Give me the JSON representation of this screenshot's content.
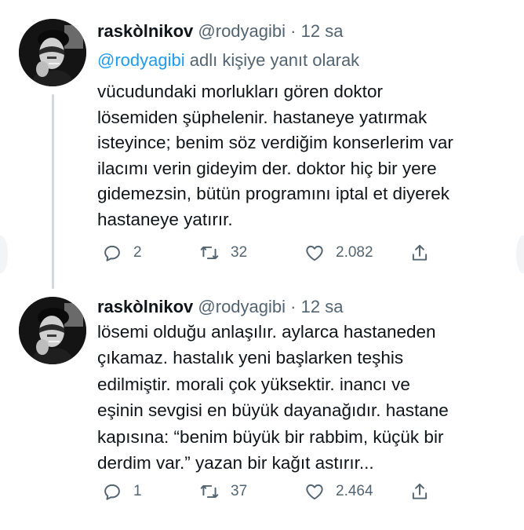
{
  "tweets": [
    {
      "author_name": "raskòlnikov",
      "handle": "@rodyagibi",
      "separator": "·",
      "time": "12 sa",
      "reply_to": {
        "mention": "@rodyagibi",
        "suffix": "adlı kişiye yanıt olarak"
      },
      "text": "vücudundaki morlukları gören doktor\nlösemiden şüphelenir. hastaneye yatırmak\nisteyince; benim söz verdiğim konserlerim var\nilacımı verin gideyim der. doktor hiç bir yere\ngidemezsin, bütün programını iptal et diyerek\nhastaneye yatırır.",
      "replies": "2",
      "retweets": "32",
      "likes": "2.082"
    },
    {
      "author_name": "raskòlnikov",
      "handle": "@rodyagibi",
      "separator": "·",
      "time": "12 sa",
      "text": "lösemi olduğu anlaşılır. aylarca hastaneden\nçıkamaz. hastalık yeni başlarken teşhis\nedilmiştir. morali çok yüksektir. inancı ve\neşinin sevgisi en büyük dayanağıdır. hastane\nkapısına: “benim büyük bir rabbim, küçük bir\nderdim var.” yazan bir kağıt astırır...",
      "replies": "1",
      "retweets": "37",
      "likes": "2.464"
    }
  ],
  "icons": [
    "reply-icon",
    "retweet-icon",
    "like-icon",
    "share-icon"
  ],
  "colors": {
    "text": "#0f1419",
    "muted": "#536471",
    "link": "#1d9bf0",
    "thread": "#cfd9de"
  }
}
